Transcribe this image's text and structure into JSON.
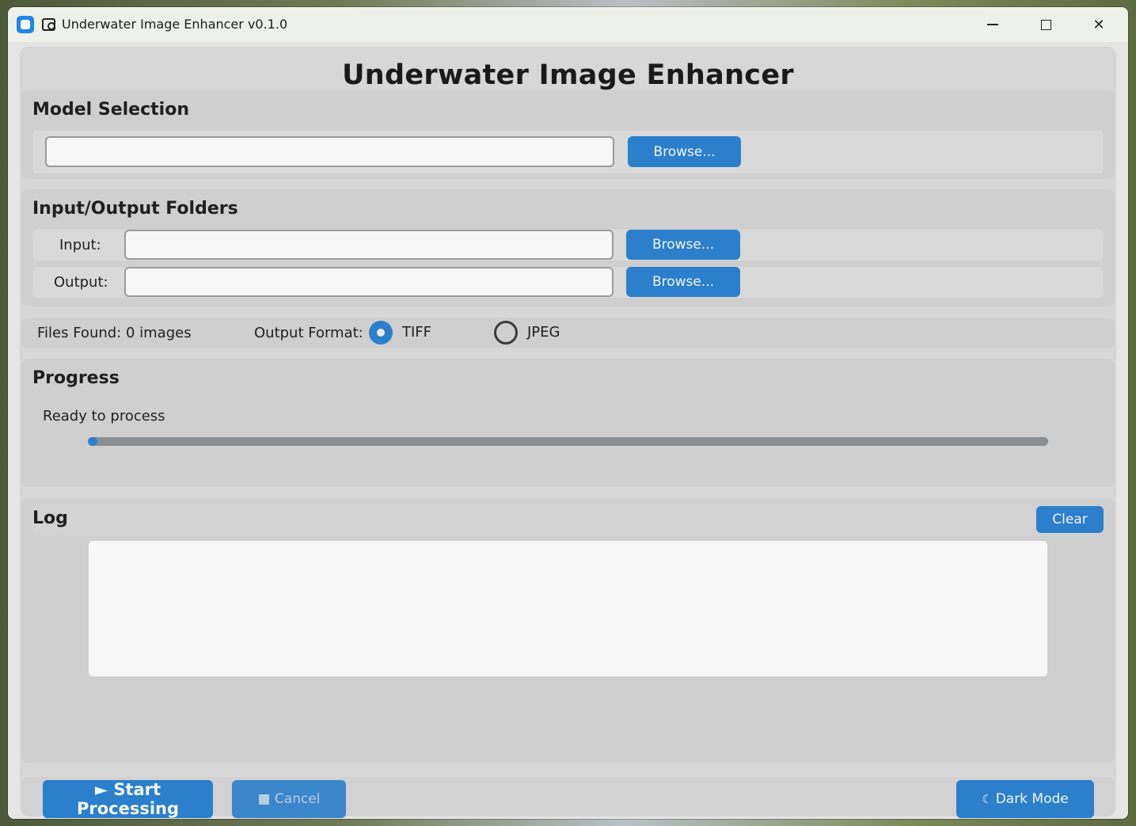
{
  "window": {
    "title": "Underwater Image Enhancer v0.1.0",
    "minimize_glyph": "—",
    "maximize_glyph": "☐",
    "close_glyph": "✕"
  },
  "app": {
    "heading": "Underwater Image Enhancer"
  },
  "model_selection": {
    "title": "Model Selection",
    "path_value": "",
    "browse_label": "Browse..."
  },
  "folders": {
    "title": "Input/Output Folders",
    "input_label": "Input:",
    "input_value": "",
    "input_browse_label": "Browse...",
    "output_label": "Output:",
    "output_value": "",
    "output_browse_label": "Browse..."
  },
  "options": {
    "files_found": "Files Found: 0 images",
    "output_format_label": "Output Format:",
    "formats": [
      {
        "label": "TIFF",
        "selected": true
      },
      {
        "label": "JPEG",
        "selected": false
      }
    ]
  },
  "progress": {
    "title": "Progress",
    "status": "Ready to process",
    "value": 0.0
  },
  "log": {
    "title": "Log",
    "clear_label": "Clear",
    "content": ""
  },
  "actions": {
    "start_label": "► Start Processing",
    "cancel_label": "■ Cancel",
    "dark_mode_label": "Dark Mode",
    "dark_mode_icon": "moon-icon"
  },
  "colors": {
    "accent": "#2b7fcb",
    "panel": "#cfcfcf",
    "window_bg": "#e5e5e5"
  }
}
